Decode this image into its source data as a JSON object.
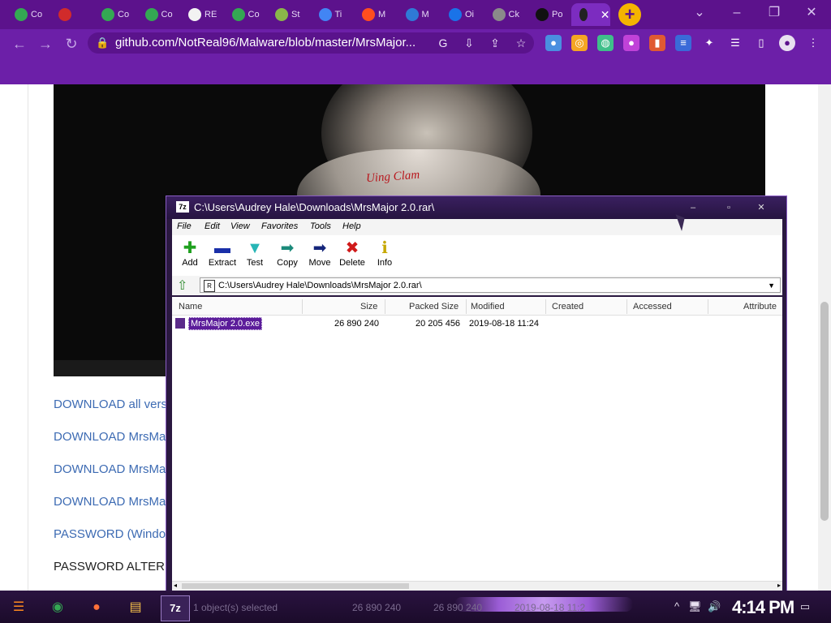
{
  "browser": {
    "tabs": [
      {
        "label": "Co",
        "icon": "check-circle-icon",
        "color": "#34a853"
      },
      {
        "label": "",
        "icon": "hd-icon",
        "color": "#d12b2b"
      },
      {
        "label": "Co",
        "icon": "check-circle-icon",
        "color": "#34a853"
      },
      {
        "label": "Co",
        "icon": "check-circle-icon",
        "color": "#34a853"
      },
      {
        "label": "RE",
        "icon": "doc-icon",
        "color": "#f2f2f2"
      },
      {
        "label": "Co",
        "icon": "check-circle-icon",
        "color": "#34a853"
      },
      {
        "label": "St",
        "icon": "grid-icon",
        "color": "#8ab64a"
      },
      {
        "label": "Ti",
        "icon": "play-icon",
        "color": "#4285f4"
      },
      {
        "label": "M",
        "icon": "shield-icon",
        "color": "#ff4e1f"
      },
      {
        "label": "M",
        "icon": "c-icon",
        "color": "#2f7ad6"
      },
      {
        "label": "Oi",
        "icon": "question-icon",
        "color": "#1a73e8"
      },
      {
        "label": "Ck",
        "icon": "globe-icon",
        "color": "#8a8a8a"
      },
      {
        "label": "Po",
        "icon": "github-icon",
        "color": "#111111"
      },
      {
        "label": "",
        "icon": "github-icon",
        "color": "#222222",
        "active": true
      }
    ],
    "url": "github.com/NotReal96/Malware/blob/master/MrsMajor..."
  },
  "page": {
    "links": [
      "DOWNLOAD all vers",
      "DOWNLOAD MrsMa",
      "DOWNLOAD MrsMa",
      "DOWNLOAD MrsMa",
      "PASSWORD (Windo"
    ],
    "password_alt": "PASSWORD ALTERN",
    "image_caption": "Uing Clam"
  },
  "zip": {
    "title": "C:\\Users\\Audrey Hale\\Downloads\\MrsMajor 2.0.rar\\",
    "app_badge": "7z",
    "menu": [
      "File",
      "Edit",
      "View",
      "Favorites",
      "Tools",
      "Help"
    ],
    "tools": [
      {
        "label": "Add",
        "glyph": "✚",
        "color": "#1fa01f"
      },
      {
        "label": "Extract",
        "glyph": "▬",
        "color": "#1a2fa8"
      },
      {
        "label": "Test",
        "glyph": "▼",
        "color": "#27b5b5"
      },
      {
        "label": "Copy",
        "glyph": "➡",
        "color": "#1b8a7a"
      },
      {
        "label": "Move",
        "glyph": "➡",
        "color": "#14257a"
      },
      {
        "label": "Delete",
        "glyph": "✖",
        "color": "#d01a1a"
      },
      {
        "label": "Info",
        "glyph": "ℹ",
        "color": "#c6a800"
      }
    ],
    "address": "C:\\Users\\Audrey Hale\\Downloads\\MrsMajor 2.0.rar\\",
    "columns": [
      "Name",
      "Size",
      "Packed Size",
      "Modified",
      "Created",
      "Accessed",
      "Attribute"
    ],
    "rows": [
      {
        "name": "MrsMajor 2.0.exe",
        "size": "26 890 240",
        "packed": "20 205 456",
        "modified": "2019-08-18 11:24"
      }
    ]
  },
  "taskbar": {
    "apps": [
      {
        "name": "start",
        "glyph": "☰",
        "color": "#ff8a1f"
      },
      {
        "name": "chrome",
        "glyph": "◉",
        "color": "#34a853"
      },
      {
        "name": "firefox",
        "glyph": "●",
        "color": "#ff7139"
      },
      {
        "name": "explorer",
        "glyph": "▤",
        "color": "#f5c04a"
      },
      {
        "name": "7zip",
        "glyph": "7z",
        "color": "#ffffff"
      }
    ],
    "status": [
      "1 object(s) selected",
      "26 890 240",
      "26 890 240",
      "2019-08-18 11:2"
    ],
    "clock": "4:14 PM"
  }
}
